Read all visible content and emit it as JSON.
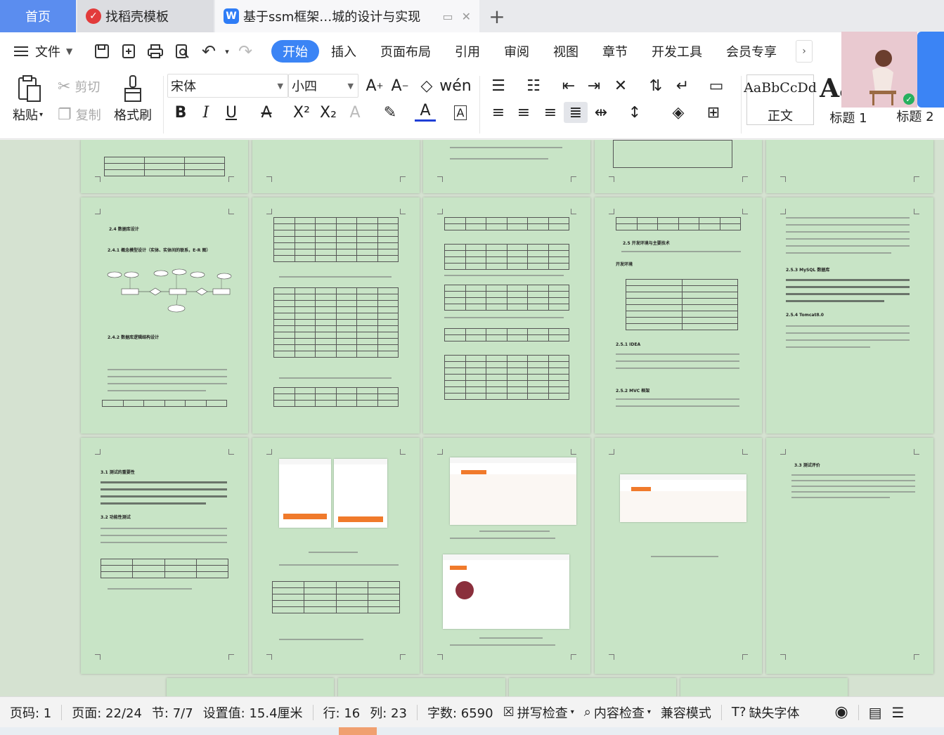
{
  "tabs": {
    "home": "首页",
    "template": "找稻壳模板",
    "doc": "基于ssm框架…城的设计与实现"
  },
  "menu": {
    "file": "文件",
    "tabs": [
      "开始",
      "插入",
      "页面布局",
      "引用",
      "审阅",
      "视图",
      "章节",
      "开发工具",
      "会员专享"
    ],
    "active_index": 0
  },
  "ribbon": {
    "paste": "粘贴",
    "cut": "剪切",
    "copy": "复制",
    "format_painter": "格式刷",
    "font_name": "宋体",
    "font_size": "小四",
    "styles": [
      {
        "preview": "AaBbCcDd",
        "name": "正文"
      },
      {
        "preview": "AaB",
        "name": "标题 1"
      },
      {
        "preview": "",
        "name": "标题 2"
      }
    ]
  },
  "pages": {
    "p1_heading_a": "2.4 数据库设计",
    "p1_heading_b": "2.4.1 概念模型设计（实体、实体间的联系，E-R 图）",
    "p1_heading_c": "2.4.2 数据库逻辑结构设计",
    "p4_heading_a": "2.5 开发环境与主要技术",
    "p4_heading_b": "开发环境",
    "p4_heading_c": "2.5.1 IDEA",
    "p4_heading_d": "2.5.2 MVC 框架",
    "p5_heading_a": "2.5.3 MySQL 数据库",
    "p5_heading_b": "2.5.4 Tomcat8.0",
    "p6_heading_a": "3.1 测试的重要性",
    "p6_heading_b": "3.2 功能性测试",
    "p10_heading_a": "3.3 测试评价"
  },
  "status": {
    "page_code": "页码: 1",
    "page": "页面: 22/24",
    "section": "节: 7/7",
    "setting": "设置值: 15.4厘米",
    "row": "行: 16",
    "col": "列: 23",
    "word_count": "字数: 6590",
    "spell_check": "拼写检查",
    "content_check": "内容检查",
    "compat_mode": "兼容模式",
    "missing_font": "缺失字体"
  }
}
